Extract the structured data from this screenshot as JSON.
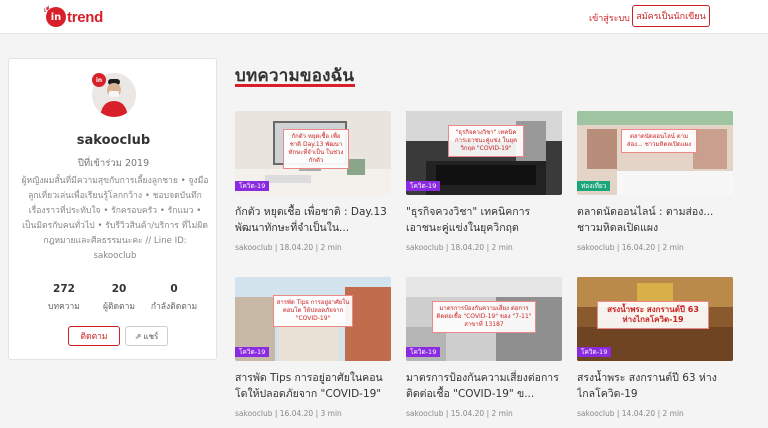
{
  "header": {
    "logo_small": "เรื่อง",
    "logo_in": "in",
    "logo_text": "trend",
    "login": "เข้าสู่ระบบ",
    "signup": "สมัครเป็นนักเขียน"
  },
  "profile": {
    "badge": "in",
    "username": "sakooclub",
    "joined": "ปีที่เข้าร่วม 2019",
    "bio": "ผู้หญิงผมสั้นที่มีความสุขกับการเลี้ยงลูกชาย • จูงมือลูกเที่ยวเล่นเพื่อเรียนรู้โลกกว้าง • ชอบจดบันทึกเรื่องราวที่ประทับใจ • รักครอบครัว • รักแมว • เป็นมิตรกับคนทั่วไป • รับรีวิวสินค้า/บริการ ที่ไม่ผิดกฎหมายและศีลธรรมนะคะ // Line ID: sakooclub",
    "stats": [
      {
        "value": "272",
        "label": "บทความ"
      },
      {
        "value": "20",
        "label": "ผู้ติดตาม"
      },
      {
        "value": "0",
        "label": "กำลังติดตาม"
      }
    ],
    "follow": "ติดตาม",
    "share": "แชร์"
  },
  "main": {
    "title": "บทความของฉัน",
    "articles": [
      {
        "title": "กักตัว หยุดเชื้อ เพื่อชาติ : Day.13 พัฒนาทักษะที่จำเป็นใน...",
        "tag": "โควิด-19",
        "author": "sakooclub",
        "date": "18.04.20",
        "read": "2 min",
        "overlay": "กักตัว หยุดเชื้อ เพื่อชาติ Day.13 พัฒนาทักษะที่จำเป็น ในช่วงกักตัว"
      },
      {
        "title": "\"ธุรกิจควงวิชา\" เทคนิคการเอาชนะคู่แข่งในยุควิกฤต \"COVI...",
        "tag": "โควิด-19",
        "author": "sakooclub",
        "date": "18.04.20",
        "read": "2 min",
        "overlay": "\"ธุรกิจควงวิชา\" เทคนิคการเอาชนะคู่แข่ง ในยุควิกฤต \"COVID-19\""
      },
      {
        "title": "ตลาดนัดออนไลน์ : ตามส่อง... ชาวมหิดลเปิดแผง",
        "tag": "ท่องเที่ยว",
        "author": "sakooclub",
        "date": "16.04.20",
        "read": "2 min",
        "overlay": "ตลาดนัดออนไลน์ ตามส่อง... ชาวมหิดลเปิดแผง"
      },
      {
        "title": "สารพัด Tips การอยู่อาศัยในคอนโดให้ปลอดภัยจาก \"COVID-19\"",
        "tag": "โควิด-19",
        "author": "sakooclub",
        "date": "16.04.20",
        "read": "3 min",
        "overlay": "สารพัด Tips การอยู่อาศัยในคอนโด ให้ปลอดภัยจาก \"COVID-19\""
      },
      {
        "title": "มาตรการป้องกันความเสี่ยงต่อการติดต่อเชื้อ \"COVID-19\" ข...",
        "tag": "โควิด-19",
        "author": "sakooclub",
        "date": "15.04.20",
        "read": "2 min",
        "overlay": "มาตรการป้องกันความเสี่ยง ต่อการติดต่อเชื้อ \"COVID-19\" ของ \"7-11\" สาขาที่ 13187"
      },
      {
        "title": "สรงน้ำพระ สงกรานต์ปี 63 ห่างไกลโควิด-19",
        "tag": "โควิด-19",
        "author": "sakooclub",
        "date": "14.04.20",
        "read": "2 min",
        "overlay": "สรงน้ำพระ สงกรานต์ปี 63 ห่างไกลโควิด-19"
      }
    ]
  },
  "colors": {
    "accent": "#d8202a"
  },
  "icons": {
    "share": "share-icon"
  }
}
